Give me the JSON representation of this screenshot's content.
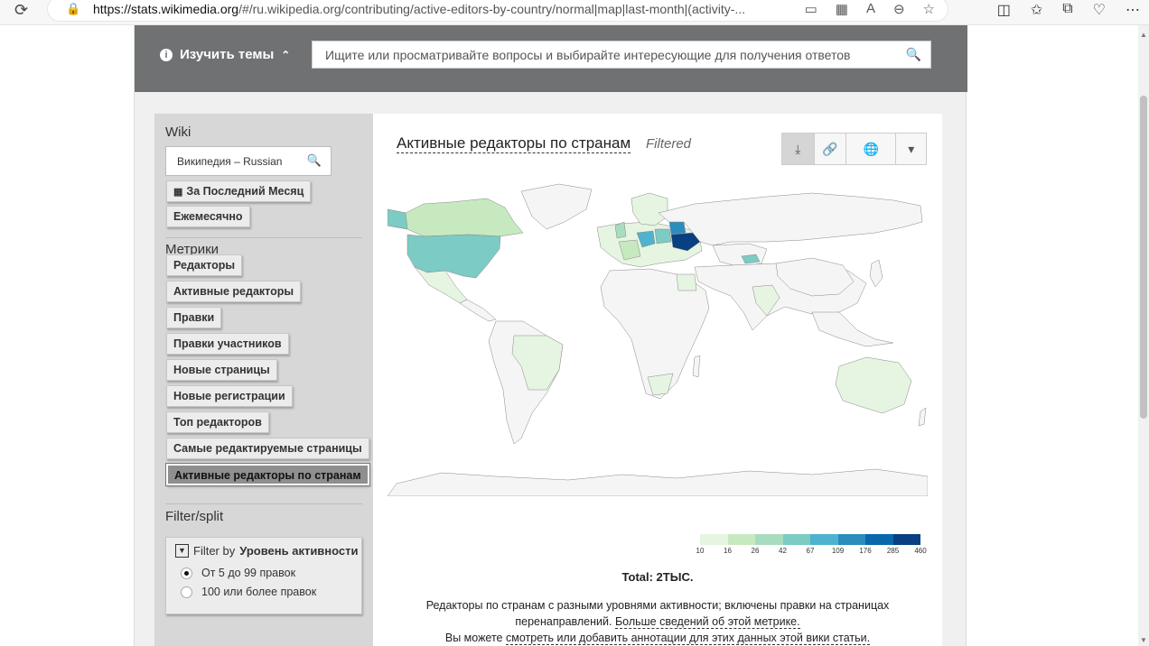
{
  "browser": {
    "url_prefix": "https://stats.wikimedia.org",
    "url_rest": "/#/ru.wikipedia.org/contributing/active-editors-by-country/normal|map|last-month|(activity-..."
  },
  "topbar": {
    "topics_label": "Изучить темы",
    "search_placeholder": "Ищите или просматривайте вопросы и выбирайте интересующие для получения ответов"
  },
  "sidebar": {
    "wiki_heading": "Wiki",
    "wiki_value": "Википедия – Russian",
    "time_range": "За Последний Месяц",
    "granularity": "Ежемесячно",
    "metrics_heading": "Метрики",
    "metrics": [
      "Редакторы",
      "Активные редакторы",
      "Правки",
      "Правки участников",
      "Новые страницы",
      "Новые регистрации",
      "Топ редакторов",
      "Самые редактируемые страницы",
      "Активные редакторы по странам"
    ],
    "active_metric_index": 8,
    "filter_heading": "Filter/split",
    "filter_by": "Filter by",
    "filter_name": "Уровень активности",
    "filter_options": [
      "От 5 до 99 правок",
      "100 или более правок"
    ],
    "filter_selected_index": 0
  },
  "card": {
    "title": "Активные редакторы по странам",
    "filtered_label": "Filtered",
    "legend_ticks": [
      "10",
      "16",
      "26",
      "42",
      "67",
      "109",
      "176",
      "285",
      "460"
    ],
    "legend_colors": [
      "#e6f5e1",
      "#c7e9c0",
      "#a8dcc0",
      "#7ccbc4",
      "#4fb3cf",
      "#2b8cbe",
      "#0868ac",
      "#084081",
      "#08306b"
    ],
    "total": "Total: 2ТЫС.",
    "desc_line1": "Редакторы по странам с разными уровнями активности; включены правки на страницах перенаправлений.",
    "desc_link1": "Больше сведений об этой метрике.",
    "desc_line2": "Вы можете",
    "desc_link2": "смотреть или добавить аннотации для этих данных этой вики статьи."
  }
}
